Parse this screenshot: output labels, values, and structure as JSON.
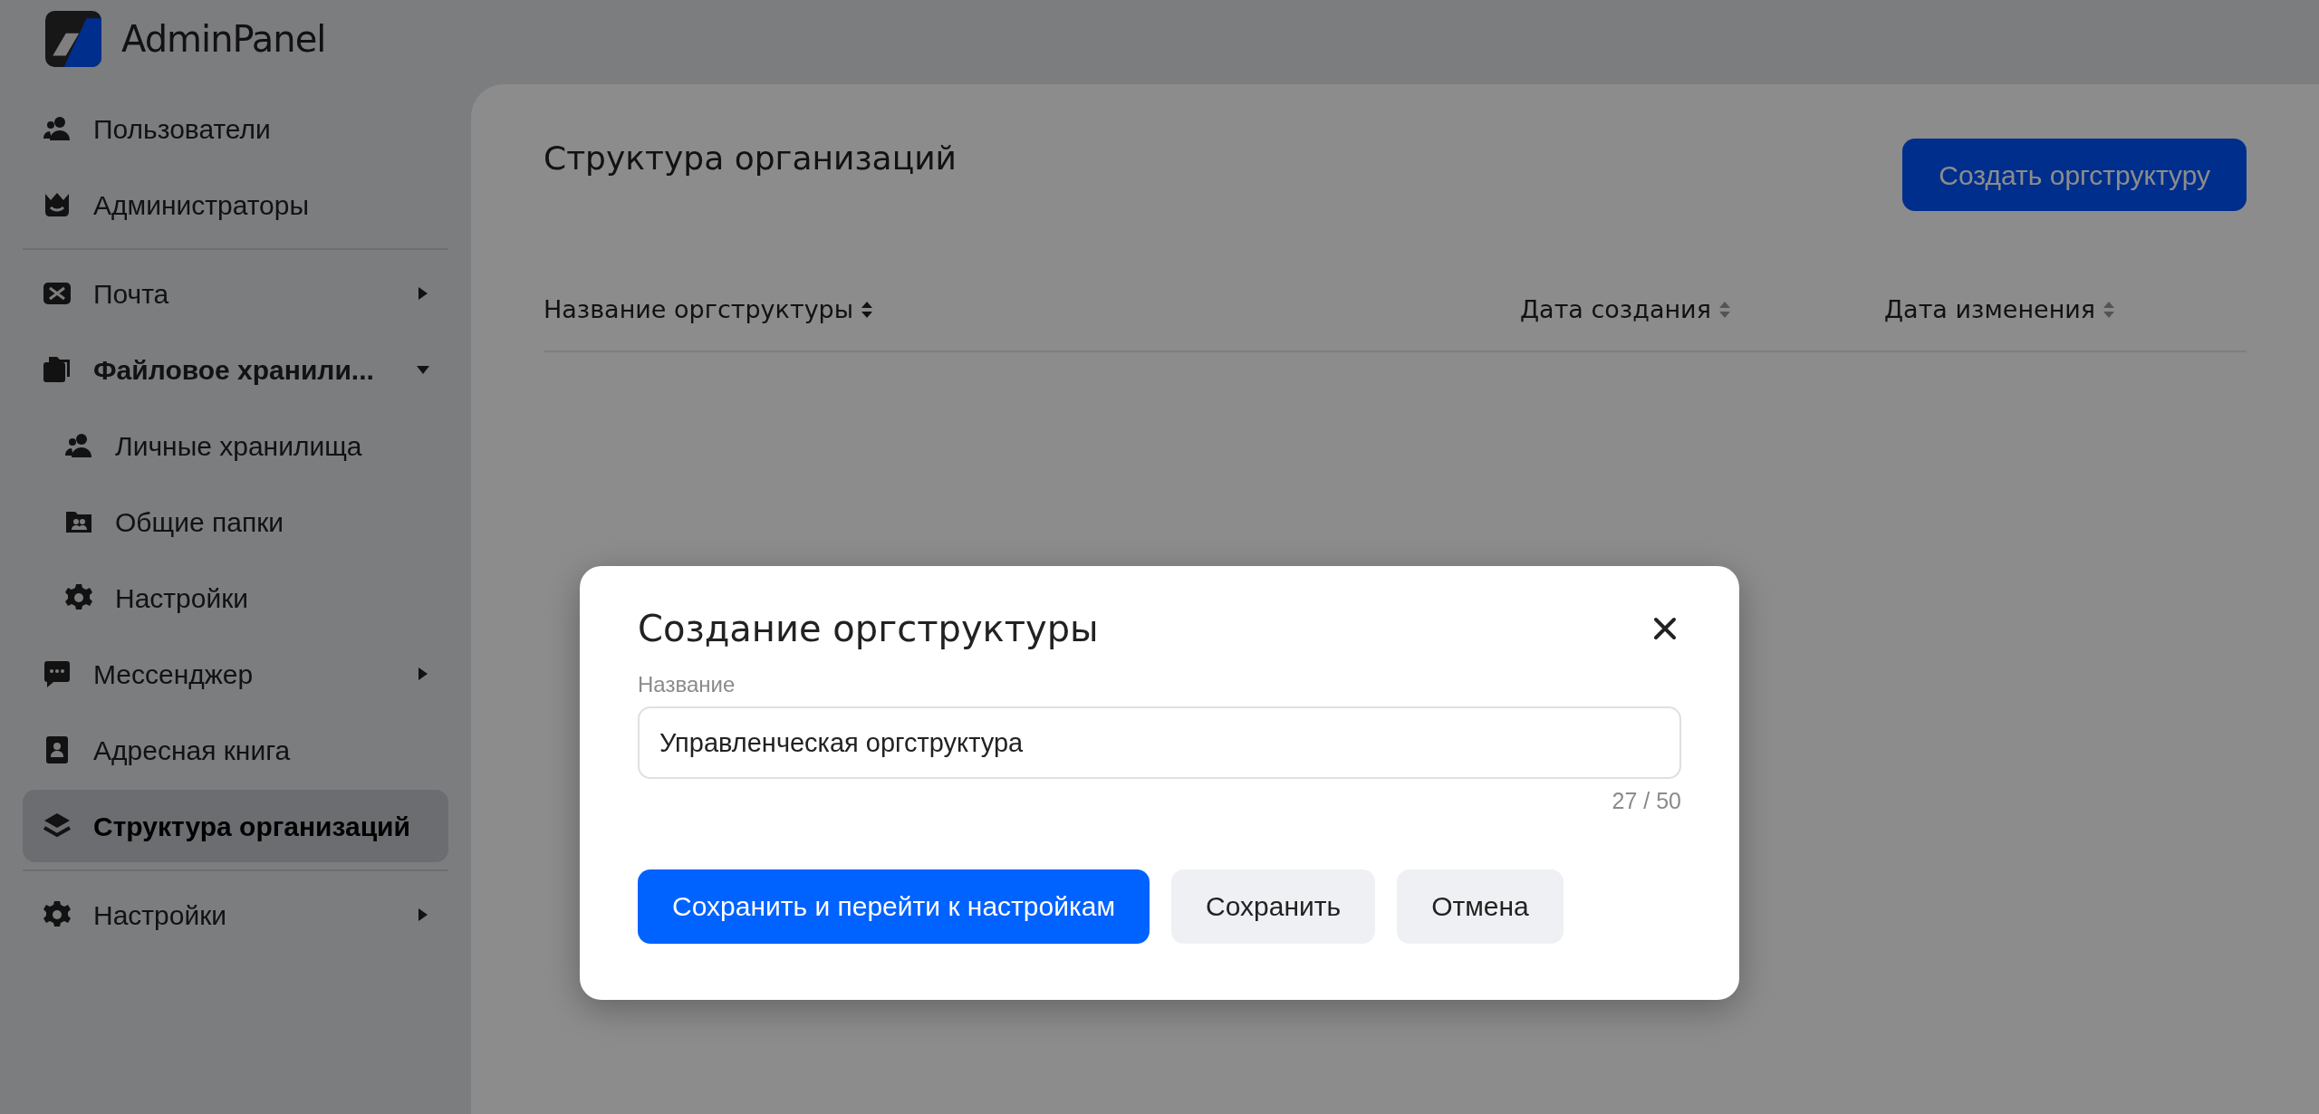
{
  "app": {
    "title": "AdminPanel"
  },
  "sidebar": {
    "groups": [
      [
        {
          "label": "Пользователи",
          "selected": false
        },
        {
          "label": "Администраторы",
          "selected": false
        }
      ],
      [
        {
          "label": "Почта",
          "selected": false,
          "expanded": false
        },
        {
          "label": "Файловое хранили...",
          "selected": false,
          "expanded": true,
          "children": [
            {
              "label": "Личные хранилища",
              "selected": false
            },
            {
              "label": "Общие папки",
              "selected": false
            },
            {
              "label": "Настройки",
              "selected": false
            }
          ]
        },
        {
          "label": "Мессенджер",
          "selected": false,
          "expanded": false
        },
        {
          "label": "Адресная книга",
          "selected": false
        },
        {
          "label": "Структура организаций",
          "selected": true
        }
      ],
      [
        {
          "label": "Настройки",
          "selected": false,
          "expanded": false
        }
      ]
    ]
  },
  "page": {
    "title": "Структура организаций",
    "create_button": "Создать оргструктуру",
    "table": {
      "columns": [
        {
          "label": "Название оргструктуры",
          "sort_active": true
        },
        {
          "label": "Дата создания",
          "sort_active": false
        },
        {
          "label": "Дата изменения",
          "sort_active": false
        }
      ]
    }
  },
  "modal": {
    "title": "Создание оргструктуры",
    "field": {
      "label": "Название",
      "value": "Управленческая оргструктура",
      "counter": "27 / 50"
    },
    "buttons": [
      {
        "label": "Сохранить и перейти к настройкам",
        "kind": "primary"
      },
      {
        "label": "Сохранить",
        "kind": "secondary"
      },
      {
        "label": "Отмена",
        "kind": "secondary"
      }
    ]
  }
}
